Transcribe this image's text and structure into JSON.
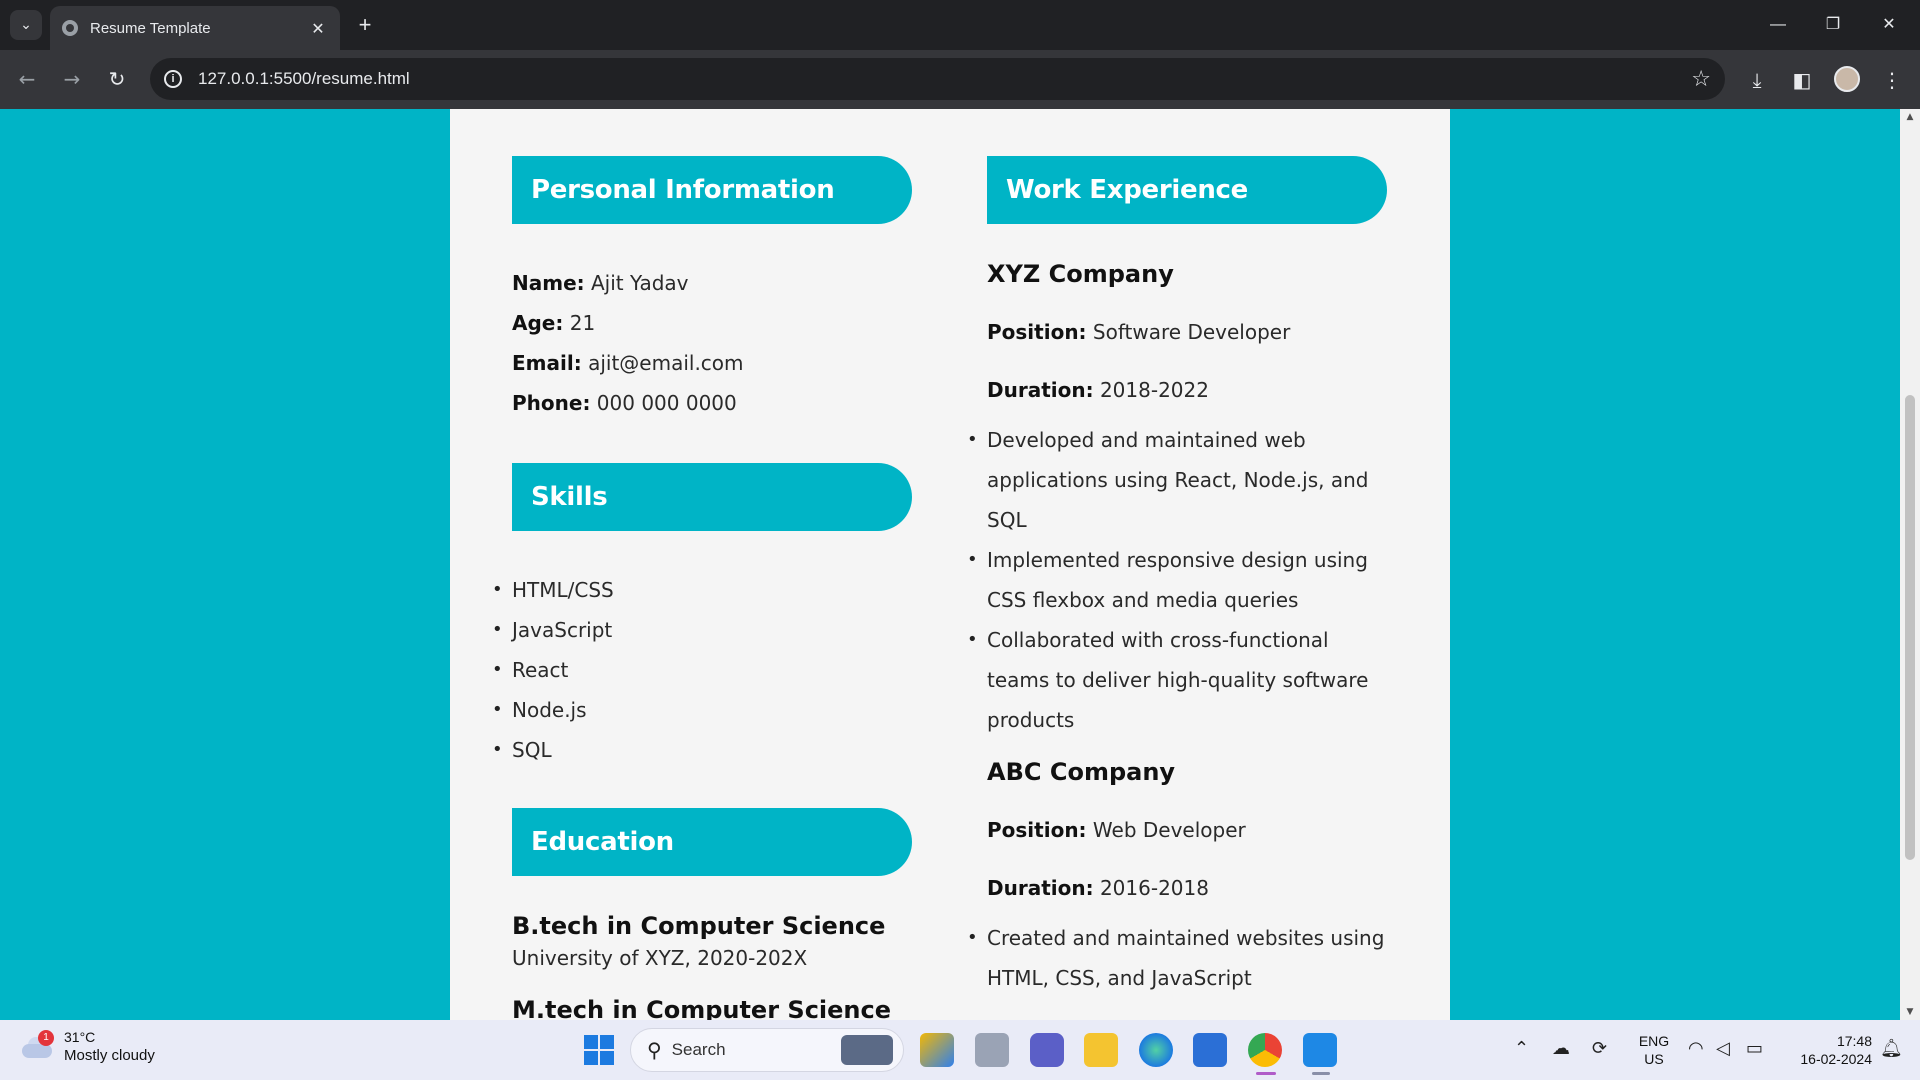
{
  "browser": {
    "tab_title": "Resume Template",
    "tab_close": "✕",
    "new_tab": "+",
    "url": "127.0.0.1:5500/resume.html",
    "minimize": "—",
    "restore": "❐",
    "close": "✕"
  },
  "resume": {
    "personal": {
      "heading": "Personal Information",
      "name_label": "Name:",
      "name_value": " Ajit Yadav",
      "age_label": "Age:",
      "age_value": " 21",
      "email_label": "Email:",
      "email_value": " ajit@email.com",
      "phone_label": "Phone:",
      "phone_value": " 000 000 0000"
    },
    "skills": {
      "heading": "Skills",
      "items": [
        "HTML/CSS",
        "JavaScript",
        "React",
        "Node.js",
        "SQL"
      ]
    },
    "education": {
      "heading": "Education",
      "items": [
        {
          "degree": "B.tech in Computer Science",
          "school": "University of XYZ, 2020-202X"
        },
        {
          "degree": "M.tech in Computer Science"
        }
      ]
    },
    "work": {
      "heading": "Work Experience",
      "position_label": "Position:",
      "duration_label": "Duration:",
      "jobs": [
        {
          "company": "XYZ Company",
          "position": " Software Developer",
          "duration": " 2018-2022",
          "bullets": [
            "Developed and maintained web applications using React, Node.js, and SQL",
            "Implemented responsive design using CSS flexbox and media queries",
            "Collaborated with cross-functional teams to deliver high-quality software products"
          ]
        },
        {
          "company": "ABC Company",
          "position": " Web Developer",
          "duration": " 2016-2018",
          "bullets": [
            "Created and maintained websites using HTML, CSS, and JavaScript"
          ]
        }
      ]
    }
  },
  "taskbar": {
    "weather_badge": "1",
    "temperature": "31°C",
    "condition": "Mostly cloudy",
    "search_label": "Search",
    "lang": "ENG",
    "region": "US",
    "time": "17:48",
    "date": "16-02-2024"
  },
  "colors": {
    "accent": "#00b4c6",
    "page_background": "#f5f5f5",
    "chrome_dark": "#202124",
    "chrome_toolbar": "#35363a"
  }
}
